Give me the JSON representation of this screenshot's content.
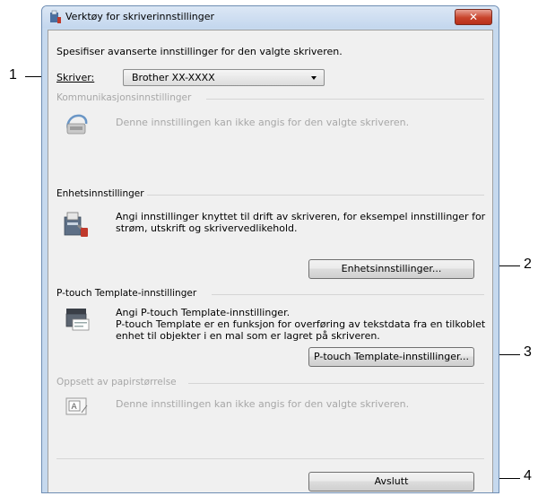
{
  "window": {
    "title": "Verktøy for skriverinnstillinger",
    "close_label": "✕"
  },
  "intro": "Spesifiser avanserte innstillinger for den valgte skriveren.",
  "printer": {
    "label": "Skriver:",
    "selected": "Brother XX-XXXX"
  },
  "sections": {
    "communication": {
      "title": "Kommunikasjonsinnstillinger",
      "description": "Denne innstillingen kan ikke angis for den valgte skriveren."
    },
    "device": {
      "title": "Enhetsinnstillinger",
      "description_lines": [
        "Angi innstillinger knyttet til drift av skriveren, for eksempel innstillinger for",
        "strøm, utskrift og skrivervedlikehold."
      ],
      "button_label": "Enhetsinnstillinger..."
    },
    "ptouch": {
      "title": "P-touch Template-innstillinger",
      "description_lines": [
        "Angi P-touch Template-innstillinger.",
        "P-touch Template er en funksjon for overføring av tekstdata fra en tilkoblet",
        "enhet til objekter i en mal som er lagret på skriveren."
      ],
      "button_label": "P-touch Template-innstillinger..."
    },
    "paper": {
      "title": "Oppsett av papirstørrelse",
      "description": "Denne innstillingen kan ikke angis for den valgte skriveren."
    }
  },
  "exit_button_label": "Avslutt",
  "callouts": [
    "1",
    "2",
    "3",
    "4"
  ],
  "colors": {
    "titlebar": "#c4d7ee",
    "close_button": "#c8432b",
    "disabled_text": "#a7a7a7"
  }
}
